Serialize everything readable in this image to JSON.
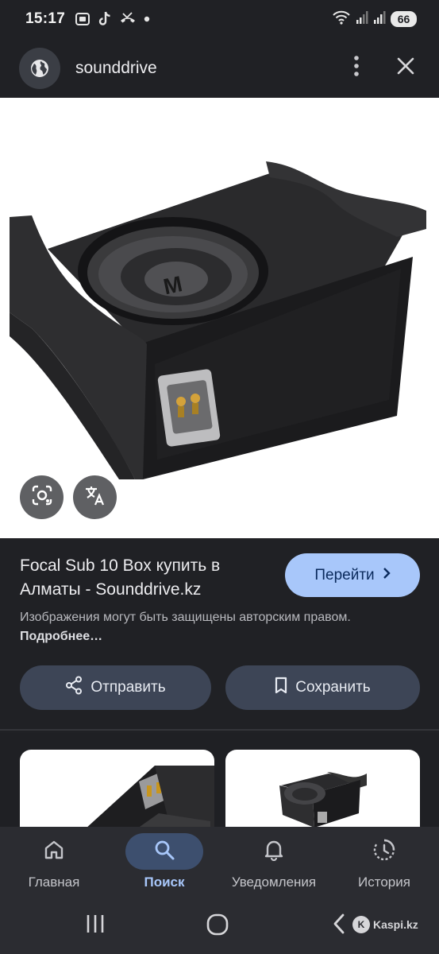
{
  "status_bar": {
    "time": "15:17",
    "battery": "66",
    "left_icons": [
      "screenshot-icon",
      "tiktok-icon",
      "missed-call-icon",
      "dot-icon"
    ],
    "right_icons": [
      "wifi-icon",
      "signal-icon",
      "signal-icon",
      "battery-icon"
    ]
  },
  "header": {
    "site_name": "sounddrive",
    "site_icon": "globe-icon",
    "more_icon": "more-vert-icon",
    "close_icon": "close-icon"
  },
  "result": {
    "title": "Focal Sub 10 Box купить в Алматы - Sounddrive.kz",
    "goto_label": "Перейти",
    "copyright_text": "Изображения могут быть защищены авторским правом.",
    "more_link": "Подробнее…",
    "share_label": "Отправить",
    "save_label": "Сохранить"
  },
  "bottom_nav": {
    "items": [
      {
        "label": "Главная",
        "icon": "home-icon"
      },
      {
        "label": "Поиск",
        "icon": "search-icon"
      },
      {
        "label": "Уведомления",
        "icon": "bell-icon"
      },
      {
        "label": "История",
        "icon": "history-icon"
      }
    ],
    "active": "Поиск"
  },
  "watermark": {
    "text": "Kaspi.kz",
    "logo_letter": "K"
  },
  "colors": {
    "background": "#202125",
    "accent": "#a8c7fa",
    "button_bg": "#3d4556",
    "nav_bg": "#2b2c31"
  }
}
